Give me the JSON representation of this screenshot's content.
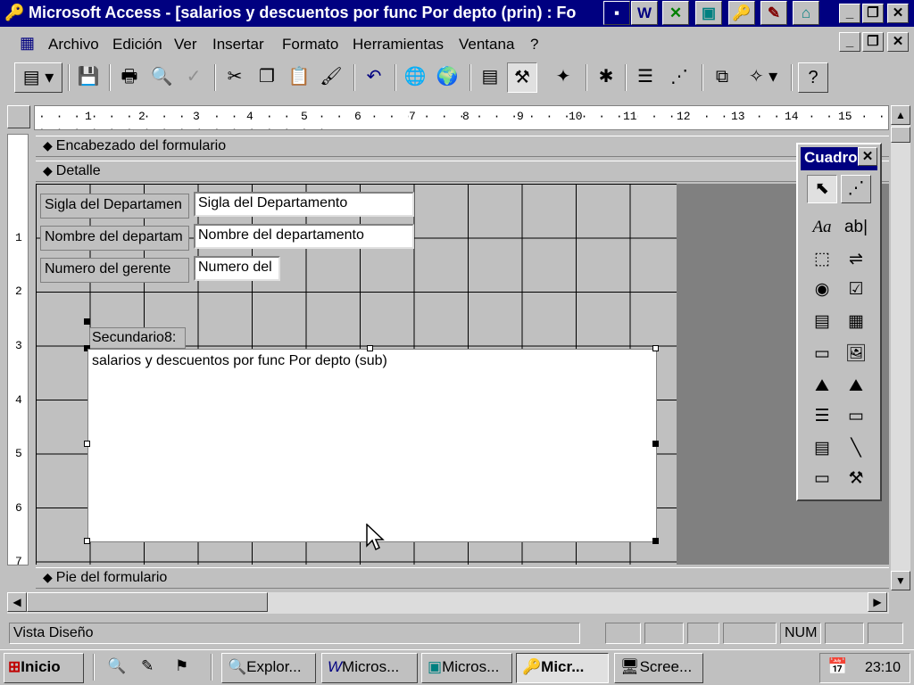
{
  "window": {
    "title": "Microsoft Access - [salarios y descuentos por func Por depto (prin) : Fo",
    "minimize": "_",
    "restore": "❐",
    "close": "✕"
  },
  "title_quick_icons": [
    "W",
    "✕",
    "▣",
    "🔑",
    "✎",
    "⌂"
  ],
  "menu": {
    "items": [
      "Archivo",
      "Edición",
      "Ver",
      "Insertar",
      "Formato",
      "Herramientas",
      "Ventana",
      "?"
    ]
  },
  "toolbar": {
    "icons": [
      "form-view-icon",
      "save-icon",
      "print-icon",
      "print-preview-icon",
      "spelling-icon",
      "cut-icon",
      "copy-icon",
      "paste-icon",
      "format-painter-icon",
      "undo-icon",
      "insert-hyperlink-icon",
      "web-toolbar-icon",
      "field-list-icon",
      "toolbox-icon",
      "autoformat-icon",
      "code-icon",
      "properties-icon",
      "build-icon",
      "database-window-icon",
      "new-object-icon",
      "help-icon"
    ]
  },
  "ruler": {
    "h_ticks": [
      "1",
      "2",
      "3",
      "4",
      "5",
      "6",
      "7",
      "8",
      "9",
      "10",
      "11",
      "12",
      "13",
      "14",
      "15"
    ],
    "v_ticks": [
      "1",
      "2",
      "3",
      "4",
      "5",
      "6",
      "7"
    ]
  },
  "sections": {
    "header": "Encabezado del formulario",
    "detail": "Detalle",
    "footer": "Pie del formulario"
  },
  "fields": [
    {
      "label": "Sigla del Departamen",
      "value": "Sigla del Departamento"
    },
    {
      "label": "Nombre del departam",
      "value": "Nombre del departamento"
    },
    {
      "label": "Numero del gerente",
      "value": "Numero del"
    }
  ],
  "subform": {
    "label": "Secundario8:",
    "source": "salarios y descuentos por func Por depto (sub)"
  },
  "toolbox": {
    "title": "Cuadro",
    "close": "✕"
  },
  "statusbar": {
    "mode": "Vista Diseño",
    "num": "NUM"
  },
  "taskbar": {
    "start": "Inicio",
    "tasks": [
      "Explor...",
      "Micros...",
      "Micros...",
      "Micr...",
      "Scree..."
    ],
    "clock": "23:10"
  }
}
